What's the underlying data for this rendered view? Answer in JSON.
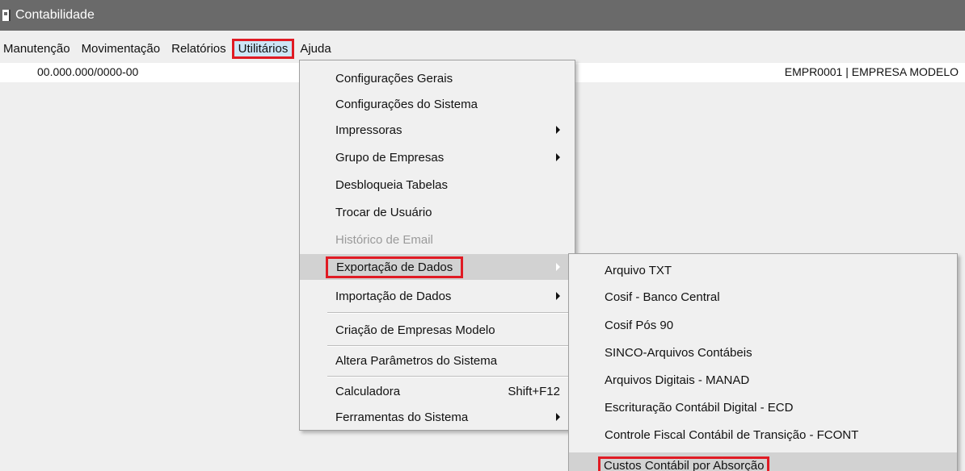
{
  "window": {
    "title": "Contabilidade"
  },
  "menubar": {
    "items": [
      "Manutenção",
      "Movimentação",
      "Relatórios",
      "Utilitários",
      "Ajuda"
    ]
  },
  "infobar": {
    "cnpj": "00.000.000/0000-00",
    "empresa": "EMPR0001 | EMPRESA MODELO"
  },
  "utilitarios_menu": {
    "items": [
      {
        "label": "Configurações Gerais"
      },
      {
        "label": "Configurações do Sistema"
      },
      {
        "label": "Impressoras",
        "submenu": true
      },
      {
        "label": "Grupo de Empresas",
        "submenu": true
      },
      {
        "label": "Desbloqueia Tabelas"
      },
      {
        "label": "Trocar de Usuário"
      },
      {
        "label": "Histórico de Email",
        "disabled": true
      },
      {
        "label": "Exportação de Dados",
        "submenu": true,
        "highlighted": true
      },
      {
        "label": "Importação de Dados",
        "submenu": true
      },
      {
        "label": "Criação de Empresas Modelo"
      },
      {
        "label": "Altera Parâmetros do Sistema"
      },
      {
        "label": "Calculadora",
        "shortcut": "Shift+F12"
      },
      {
        "label": "Ferramentas do Sistema",
        "submenu": true
      }
    ]
  },
  "exportacao_submenu": {
    "items": [
      {
        "label": "Arquivo TXT"
      },
      {
        "label": "Cosif - Banco Central"
      },
      {
        "label": "Cosif Pós 90"
      },
      {
        "label": "SINCO-Arquivos Contábeis"
      },
      {
        "label": "Arquivos Digitais - MANAD"
      },
      {
        "label": "Escrituração Contábil Digital - ECD"
      },
      {
        "label": "Controle Fiscal Contábil de Transição - FCONT"
      },
      {
        "label": "Custos Contábil por Absorção",
        "highlighted": true
      }
    ]
  },
  "colors": {
    "titlebar": "#6a6a6a",
    "highlight_border": "#e01b24",
    "menu_background": "#f0f0f0",
    "selected_item": "#d2d2d2"
  }
}
